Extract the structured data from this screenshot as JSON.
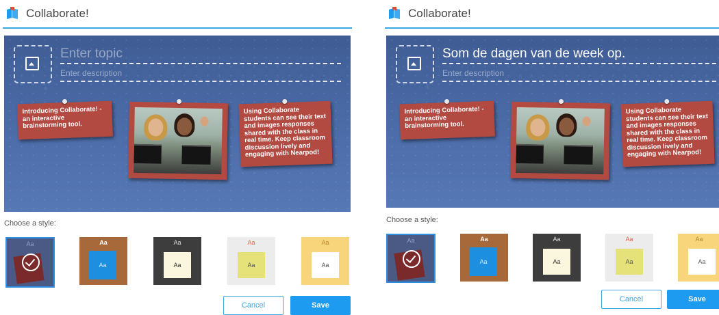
{
  "panels": [
    {
      "header": {
        "title": "Collaborate!"
      },
      "board": {
        "topic_text": "",
        "topic_placeholder": "Enter topic",
        "description_placeholder": "Enter description",
        "notes": [
          "Introducing Collaborate! - an interactive brainstorming tool.",
          "Using Collaborate students can see their text and images responses shared with the class in real time. Keep classroom discussion lively and engaging with Nearpod!"
        ]
      },
      "style_label": "Choose a style:",
      "styles": [
        {
          "name": "dark-blue",
          "top": "Aa",
          "selected": true
        },
        {
          "name": "cork",
          "top": "Aa",
          "card": "Aa",
          "selected": false
        },
        {
          "name": "chalkboard",
          "top": "Aa",
          "card": "Aa",
          "selected": false
        },
        {
          "name": "paper",
          "top": "Aa",
          "card": "Aa",
          "selected": false
        },
        {
          "name": "yellow",
          "top": "Aa",
          "card": "Aa",
          "selected": false
        }
      ],
      "buttons": {
        "cancel": "Cancel",
        "save": "Save"
      }
    },
    {
      "header": {
        "title": "Collaborate!"
      },
      "board": {
        "topic_text": "Som de dagen van de week op.",
        "topic_placeholder": "Enter topic",
        "description_placeholder": "Enter description",
        "notes": [
          "Introducing Collaborate! - an interactive brainstorming tool.",
          "Using Collaborate students can see their text and images responses shared with the class in real time. Keep classroom discussion lively and engaging with Nearpod!"
        ]
      },
      "style_label": "Choose a style:",
      "styles": [
        {
          "name": "dark-blue",
          "top": "Aa",
          "selected": true
        },
        {
          "name": "cork",
          "top": "Aa",
          "card": "Aa",
          "selected": false
        },
        {
          "name": "chalkboard",
          "top": "Aa",
          "card": "Aa",
          "selected": false
        },
        {
          "name": "paper",
          "top": "Aa",
          "card": "Aa",
          "selected": false
        },
        {
          "name": "yellow",
          "top": "Aa",
          "card": "Aa",
          "selected": false
        }
      ],
      "buttons": {
        "cancel": "Cancel",
        "save": "Save"
      }
    }
  ],
  "colors": {
    "accent": "#3aa7e0",
    "save": "#1d9bf0",
    "note": "#b24a42",
    "board": "#4a6aa6"
  }
}
